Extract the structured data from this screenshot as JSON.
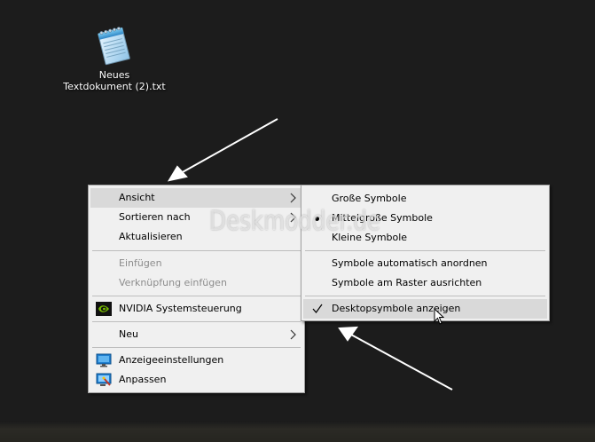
{
  "desktop": {
    "file_icon": {
      "icon": "notepad-document-icon",
      "label_line1": "Neues",
      "label_line2": "Textdokument (2).txt"
    },
    "watermark": "Deskmodder.de"
  },
  "context_menu": {
    "items": [
      {
        "label": "Ansicht",
        "state": "highlighted",
        "has_submenu": true
      },
      {
        "label": "Sortieren nach",
        "has_submenu": true
      },
      {
        "label": "Aktualisieren"
      },
      {
        "label": "Einfügen",
        "state": "disabled"
      },
      {
        "label": "Verknüpfung einfügen",
        "state": "disabled"
      },
      {
        "label": "NVIDIA Systemsteuerung",
        "icon": "nvidia-icon"
      },
      {
        "label": "Neu",
        "has_submenu": true
      },
      {
        "label": "Anzeigeeinstellungen",
        "icon": "display-settings-icon"
      },
      {
        "label": "Anpassen",
        "icon": "personalize-icon"
      }
    ]
  },
  "view_submenu": {
    "items": [
      {
        "label": "Große Symbole"
      },
      {
        "label": "Mittelgroße Symbole",
        "selected": true
      },
      {
        "label": "Kleine Symbole"
      },
      {
        "label": "Symbole automatisch anordnen"
      },
      {
        "label": "Symbole am Raster ausrichten"
      },
      {
        "label": "Desktopsymbole anzeigen",
        "checked": true,
        "state": "highlighted"
      }
    ]
  },
  "colors": {
    "desktop_bg": "#1c1c1c",
    "menu_bg": "#f0f0f0",
    "menu_highlight": "#d9d9d9",
    "disabled_text": "#8c8c8c",
    "nvidia_green": "#76b900"
  }
}
